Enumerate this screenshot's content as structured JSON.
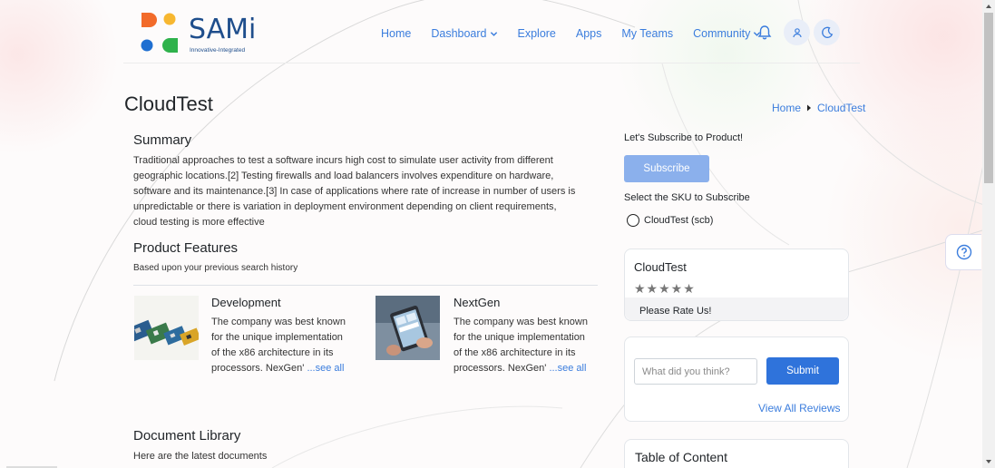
{
  "brand": {
    "name": "SAMi",
    "tagline": "Innovative-Integrated",
    "colors": {
      "orange": "#f26b2a",
      "yellow": "#f7b730",
      "blue": "#1f6fd1",
      "green": "#2fb24c",
      "navy": "#1f4e8c"
    }
  },
  "nav": {
    "home": "Home",
    "dashboard": "Dashboard",
    "explore": "Explore",
    "apps": "Apps",
    "my_teams": "My Teams",
    "community": "Community"
  },
  "header_icons": [
    "bell-icon",
    "user-icon",
    "moon-icon"
  ],
  "page": {
    "title": "CloudTest",
    "breadcrumb": [
      "Home",
      "CloudTest"
    ]
  },
  "summary": {
    "heading": "Summary",
    "lines": [
      "Traditional approaches to test a software incurs high cost to simulate user activity from different",
      "geographic locations.[2] Testing firewalls and load balancers involves expenditure on hardware,",
      "software and its maintenance.[3] In case of applications where rate of increase in number of users is",
      "unpredictable or there is variation in deployment environment depending on client requirements,",
      "cloud testing is more effective"
    ]
  },
  "features": {
    "heading": "Product Features",
    "subtitle": "Based upon your previous search history",
    "cards": [
      {
        "title": "Development",
        "lines": [
          "The company was best known",
          "for the unique implementation",
          "of the x86 architecture in its",
          "processors. NexGen'"
        ],
        "more": "...see all"
      },
      {
        "title": "NextGen",
        "lines": [
          "The company was best known",
          "for the unique implementation",
          "of the x86 architecture in its",
          "processors. NexGen'"
        ],
        "more": "...see all"
      }
    ]
  },
  "documents": {
    "heading": "Document Library",
    "subtitle": "Here are the latest documents"
  },
  "subscribe": {
    "prompt": "Let's Subscribe to Product!",
    "button": "Subscribe",
    "sku_prompt": "Select the SKU to Subscribe",
    "sku_option": "CloudTest (scb)"
  },
  "rating": {
    "product": "CloudTest",
    "stars": "★★★★★",
    "rated": 0,
    "max": 5,
    "prompt": "Please Rate Us!"
  },
  "review": {
    "placeholder": "What did you think?",
    "submit": "Submit",
    "view_all": "View All Reviews"
  },
  "toc": {
    "heading": "Table of Content"
  }
}
